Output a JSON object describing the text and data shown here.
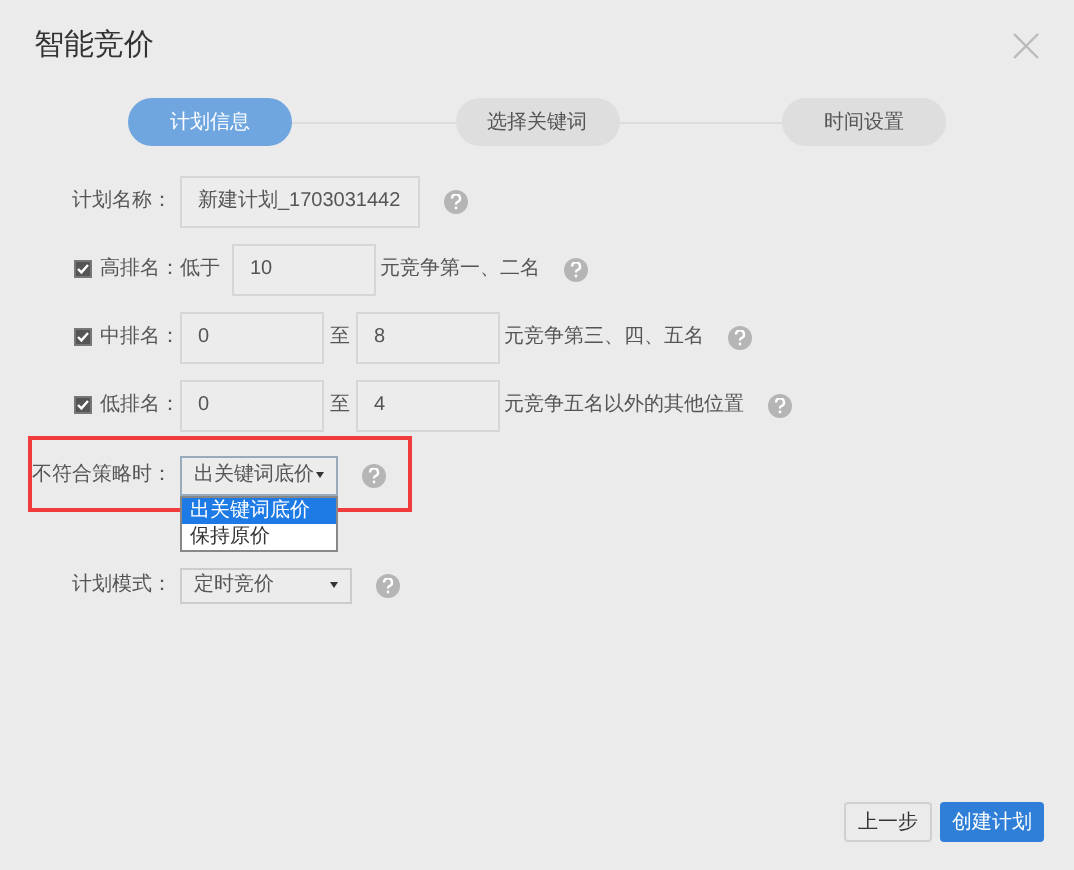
{
  "dialog": {
    "title": "智能竞价"
  },
  "steps": [
    {
      "label": "计划信息",
      "selected": true
    },
    {
      "label": "选择关键词",
      "selected": false
    },
    {
      "label": "时间设置",
      "selected": false
    }
  ],
  "plan_name": {
    "label": "计划名称：",
    "value": "新建计划_1703031442"
  },
  "rankings": [
    {
      "kind": "single",
      "checked": true,
      "label": "高排名：",
      "prefix": "低于",
      "value": "10",
      "suffix": "元竞争第一、二名"
    },
    {
      "kind": "range",
      "checked": true,
      "label": "中排名：",
      "from": "0",
      "to_label": "至",
      "to": "8",
      "suffix": "元竞争第三、四、五名"
    },
    {
      "kind": "range",
      "checked": true,
      "label": "低排名：",
      "from": "0",
      "to_label": "至",
      "to": "4",
      "suffix": "元竞争五名以外的其他位置"
    }
  ],
  "strategy": {
    "label": "不符合策略时：",
    "value": "出关键词底价",
    "options": [
      {
        "label": "出关键词底价",
        "selected": true
      },
      {
        "label": "保持原价",
        "selected": false
      }
    ]
  },
  "plan_mode": {
    "label": "计划模式：",
    "value": "定时竞价"
  },
  "buttons": [
    {
      "label": "上一步",
      "kind": "secondary"
    },
    {
      "label": "创建计划",
      "kind": "primary"
    }
  ]
}
